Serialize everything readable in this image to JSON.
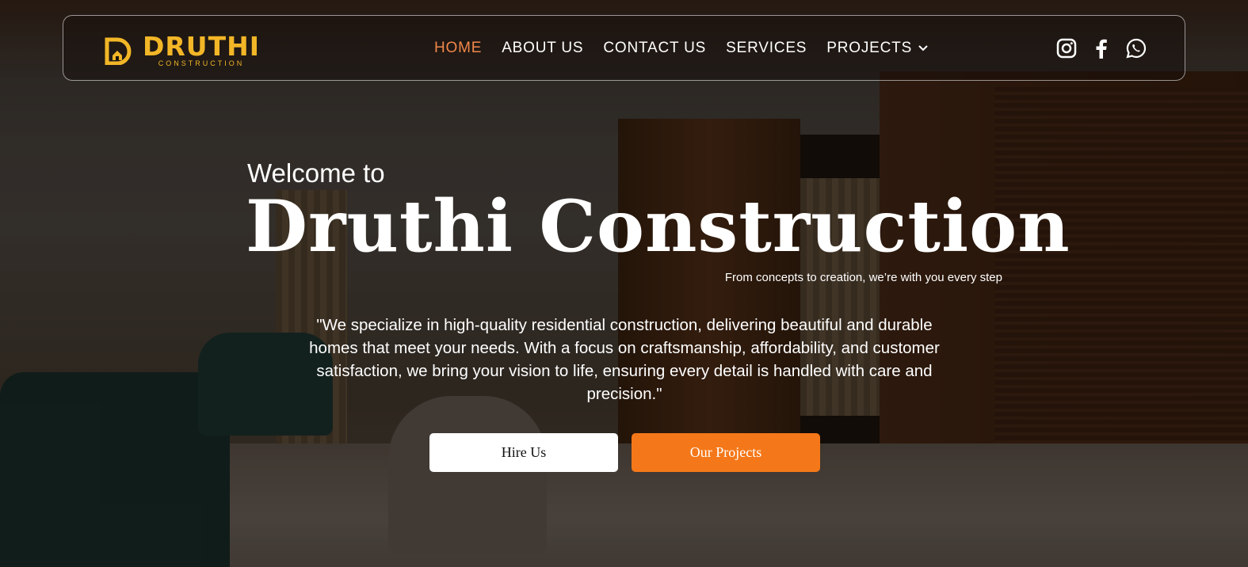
{
  "brand": {
    "name": "DRUTHI",
    "subtitle": "CONSTRUCTION",
    "color": "#f2b627"
  },
  "nav": {
    "items": [
      {
        "label": "HOME",
        "active": true
      },
      {
        "label": "ABOUT US",
        "active": false
      },
      {
        "label": "CONTACT US",
        "active": false
      },
      {
        "label": "SERVICES",
        "active": false
      },
      {
        "label": "PROJECTS",
        "active": false,
        "has_dropdown": true
      }
    ],
    "active_color": "#f1874a",
    "socials": [
      "instagram-icon",
      "facebook-icon",
      "whatsapp-icon"
    ]
  },
  "hero": {
    "welcome": "Welcome to",
    "title": "Druthi Construction",
    "tagline": "From concepts to creation, we’re with you every step",
    "quote": "\"We specialize in high-quality residential construction, delivering beautiful and durable homes that meet your needs. With a focus on craftsmanship, affordability, and customer satisfaction, we bring your vision to life, ensuring every detail is handled with care and precision.\"",
    "buttons": {
      "hire": "Hire Us",
      "projects": "Our Projects"
    },
    "accent": "#f47819"
  }
}
